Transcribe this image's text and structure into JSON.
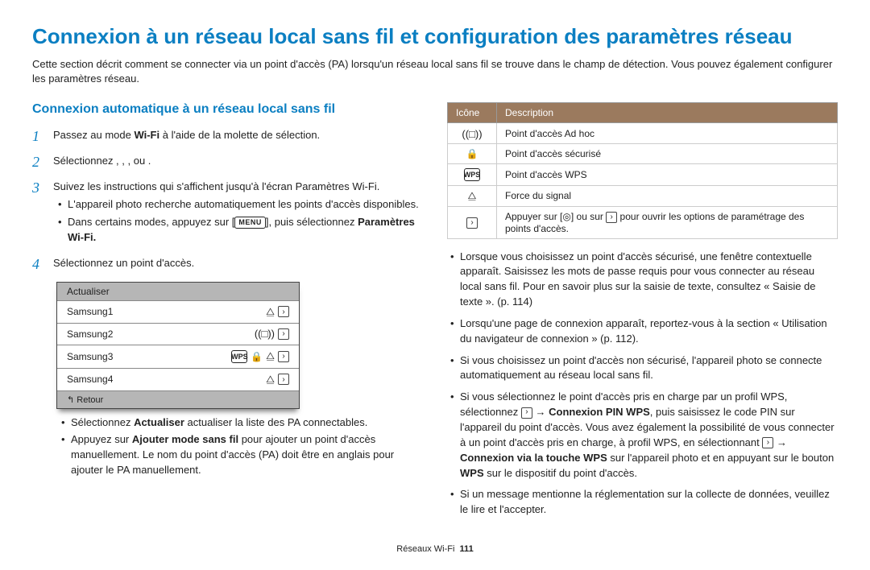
{
  "title": "Connexion à un réseau local sans fil et configuration des paramètres réseau",
  "intro": "Cette section décrit comment se connecter via un point d'accès (PA) lorsqu'un réseau local sans fil se trouve dans le champ de détection. Vous pouvez également configurer les paramètres réseau.",
  "section_heading": "Connexion automatique à un réseau local sans fil",
  "steps": {
    "s1_num": "1",
    "s1_pre": "Passez au mode ",
    "s1_wifi": "Wi-Fi",
    "s1_post": " à l'aide de la molette de sélection.",
    "s2_num": "2",
    "s2_text": "Sélectionnez      ,        ,        ,           ou        .",
    "s3_num": "3",
    "s3_text": "Suivez les instructions qui s'affichent jusqu'à l'écran Paramètres Wi-Fi.",
    "s3_b1": "L'appareil photo recherche automatiquement les points d'accès disponibles.",
    "s3_b2_pre": "Dans certains modes, appuyez sur [",
    "s3_b2_menu": "MENU",
    "s3_b2_mid": "], puis sélectionnez ",
    "s3_b2_strong": "Paramètres Wi-Fi.",
    "s4_num": "4",
    "s4_text": "Sélectionnez un point d'accès."
  },
  "screenshot": {
    "refresh": "Actualiser",
    "r1": "Samsung1",
    "r2": "Samsung2",
    "r3": "Samsung3",
    "r4": "Samsung4",
    "back": "↰ Retour"
  },
  "after_bullets": {
    "b1_pre": "Sélectionnez ",
    "b1_strong": "Actualiser",
    "b1_post": " actualiser la liste des PA connectables.",
    "b2_pre": "Appuyez sur ",
    "b2_strong": "Ajouter mode sans fil",
    "b2_post": " pour ajouter un point d'accès manuellement. Le nom du point d'accès (PA) doit être en anglais pour ajouter le PA manuellement."
  },
  "table": {
    "h1": "Icône",
    "h2": "Description",
    "r1": "Point d'accès Ad hoc",
    "r2": "Point d'accès sécurisé",
    "r3": "Point d'accès WPS",
    "r4": "Force du signal",
    "r5_pre": "Appuyer sur [",
    "r5_mid": "] ou sur ",
    "r5_post": " pour ouvrir les options de paramétrage des points d'accès."
  },
  "right_bullets": {
    "b1": "Lorsque vous choisissez un point d'accès sécurisé, une fenêtre contextuelle apparaît. Saisissez les mots de passe requis pour vous connecter au réseau local sans fil. Pour en savoir plus sur la saisie de texte, consultez « Saisie de texte ». (p. 114)",
    "b2": "Lorsqu'une page de connexion apparaît, reportez-vous à la section « Utilisation du navigateur de connexion » (p. 112).",
    "b3": "Si vous choisissez un point d'accès non sécurisé, l'appareil photo se connecte automatiquement au réseau local sans fil.",
    "b4_pre": "Si vous sélectionnez le point d'accès pris en charge par un profil WPS, sélectionnez ",
    "b4_arrow1": " → ",
    "b4_s1": "Connexion PIN WPS",
    "b4_mid": ", puis saisissez le code PIN sur l'appareil du point d'accès. Vous avez également la possibilité de vous connecter à un point d'accès pris en charge, à profil WPS, en sélectionnant ",
    "b4_arrow2": " → ",
    "b4_s2": "Connexion via la touche WPS",
    "b4_post": " sur l'appareil photo et en appuyant sur le bouton ",
    "b4_s3": "WPS",
    "b4_end": " sur le dispositif du point d'accès.",
    "b5": "Si un message mentionne la réglementation sur la collecte de données, veuillez le lire et l'accepter."
  },
  "footer": {
    "section": "Réseaux Wi-Fi",
    "page": "111"
  }
}
